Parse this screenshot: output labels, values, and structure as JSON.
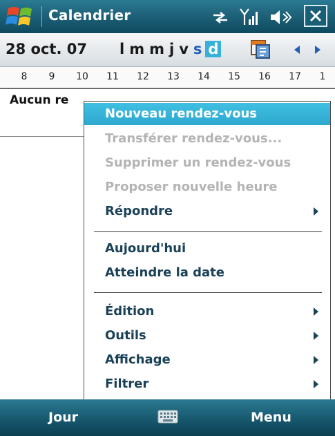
{
  "title_bar": {
    "app_title": "Calendrier"
  },
  "date_bar": {
    "date_label": "28 oct. 07",
    "weekdays": [
      "l",
      "m",
      "m",
      "j",
      "v",
      "s",
      "d"
    ],
    "selected_weekday_index": 6
  },
  "hours_bar": {
    "hours": [
      "8",
      "9",
      "10",
      "11",
      "12",
      "13",
      "14",
      "15",
      "16",
      "17",
      "1"
    ]
  },
  "agenda": {
    "empty_text": "Aucun re"
  },
  "context_menu": {
    "items": [
      {
        "label": "Nouveau rendez-vous",
        "state": "highlighted"
      },
      {
        "label": "Transférer rendez-vous...",
        "state": "disabled"
      },
      {
        "label": "Supprimer un rendez-vous",
        "state": "disabled"
      },
      {
        "label": "Proposer nouvelle heure",
        "state": "disabled"
      },
      {
        "label": "Répondre",
        "state": "enabled",
        "submenu": true
      },
      {
        "label": "Aujourd'hui",
        "state": "enabled"
      },
      {
        "label": "Atteindre la date",
        "state": "enabled"
      },
      {
        "label": "Édition",
        "state": "enabled",
        "submenu": true
      },
      {
        "label": "Outils",
        "state": "enabled",
        "submenu": true
      },
      {
        "label": "Affichage",
        "state": "enabled",
        "submenu": true
      },
      {
        "label": "Filtrer",
        "state": "enabled",
        "submenu": true
      }
    ]
  },
  "soft_keys": {
    "left": "Jour",
    "right": "Menu"
  },
  "colors": {
    "title_bar": "#1e6279",
    "highlight": "#36b2d8",
    "menu_text": "#1a4157",
    "disabled_text": "#b4b4b4",
    "saturday": "#1f5fb6"
  },
  "icons": [
    "windows-start-icon",
    "sync-arrows-icon",
    "signal-icon",
    "speaker-icon",
    "close-icon",
    "calendar-icon",
    "chevron-left-icon",
    "chevron-right-icon",
    "keyboard-icon"
  ]
}
